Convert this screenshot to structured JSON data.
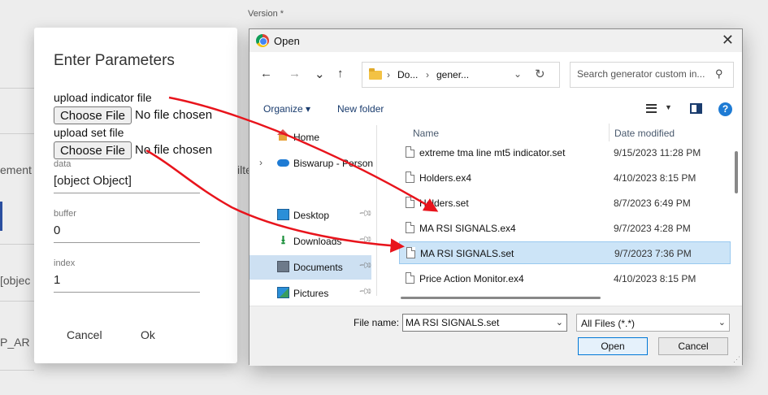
{
  "background": {
    "version_label": "Version *",
    "left_text_1": "ement",
    "right_text_1": "ilte",
    "left_text_2": "[objec",
    "left_text_3": "P_AR"
  },
  "param_dialog": {
    "title": "Enter Parameters",
    "upload_indicator_label": "upload indicator file",
    "upload_set_label": "upload set file",
    "choose_file_label": "Choose File",
    "no_file_text": "No file chosen",
    "fields": [
      {
        "label": "data",
        "value": "[object Object]"
      },
      {
        "label": "buffer",
        "value": "0"
      },
      {
        "label": "index",
        "value": "1"
      }
    ],
    "cancel_label": "Cancel",
    "ok_label": "Ok"
  },
  "open_dialog": {
    "title": "Open",
    "close_icon": "✕",
    "nav": {
      "back": "←",
      "forward": "→",
      "recent": "⌄",
      "up": "↑"
    },
    "address": {
      "crumb_1": "Do...",
      "crumb_2": "gener...",
      "sep": "›"
    },
    "search_placeholder": "Search generator custom in...",
    "toolbar": {
      "organize_label": "Organize ▾",
      "new_folder_label": "New folder"
    },
    "nav_pane": [
      {
        "label": "Home",
        "icon": "home-icon",
        "pinned": false
      },
      {
        "label": "Biswarup - Person",
        "icon": "onedrive-cloud-icon",
        "pinned": false,
        "expandable": true
      },
      {
        "label": "Desktop",
        "icon": "desktop-icon",
        "pinned": true
      },
      {
        "label": "Downloads",
        "icon": "downloads-icon",
        "pinned": true
      },
      {
        "label": "Documents",
        "icon": "documents-icon",
        "pinned": true,
        "selected": true
      },
      {
        "label": "Pictures",
        "icon": "pictures-icon",
        "pinned": true
      }
    ],
    "columns": {
      "name": "Name",
      "date_modified": "Date modified"
    },
    "files": [
      {
        "name": "extreme tma line mt5 indicator.set",
        "date": "9/15/2023 11:28 PM"
      },
      {
        "name": "Holders.ex4",
        "date": "4/10/2023 8:15 PM"
      },
      {
        "name": "Holders.set",
        "date": "8/7/2023 6:49 PM"
      },
      {
        "name": "MA RSI SIGNALS.ex4",
        "date": "9/7/2023 4:28 PM"
      },
      {
        "name": "MA RSI SIGNALS.set",
        "date": "9/7/2023 7:36 PM",
        "selected": true
      },
      {
        "name": "Price Action Monitor.ex4",
        "date": "4/10/2023 8:15 PM"
      }
    ],
    "file_name_label": "File name:",
    "file_name_value": "MA RSI SIGNALS.set",
    "file_type_value": "All Files (*.*)",
    "open_label": "Open",
    "cancel_label": "Cancel"
  },
  "colors": {
    "arrow": "#e8141c",
    "selection": "#cce4f7",
    "accent": "#0078d7"
  }
}
